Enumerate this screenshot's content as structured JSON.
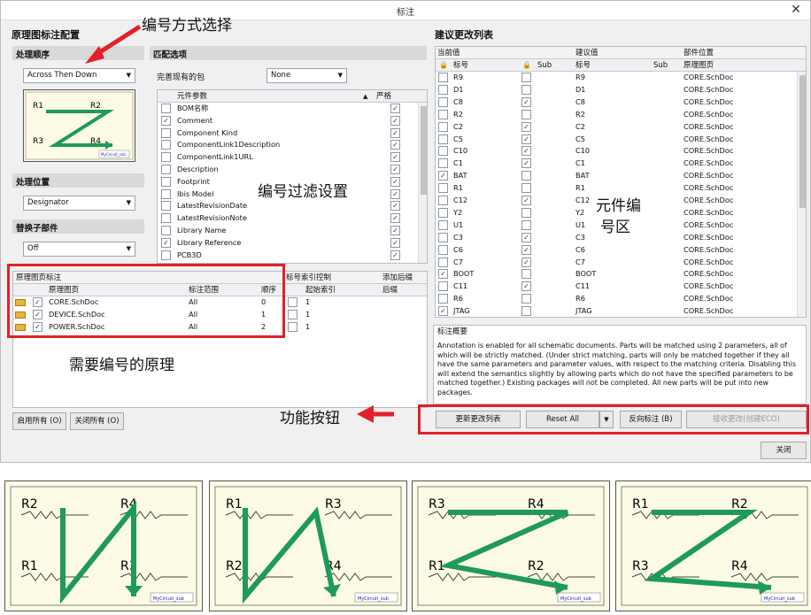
{
  "window": {
    "title": "标注",
    "close": "✕"
  },
  "left": {
    "title": "原理图标注配置",
    "order_section": "处理顺序",
    "order_value": "Across Then Down",
    "location_section": "处理位置",
    "location_value": "Designator",
    "replace_section": "替换子部件",
    "replace_value": "Off",
    "match_section": "匹配选项",
    "complete_label": "完善现有的包",
    "complete_value": "None",
    "param_header": "元件参数",
    "strict_header": "严格",
    "params": [
      {
        "name": "BOM名称",
        "checked": false
      },
      {
        "name": "Comment",
        "checked": true
      },
      {
        "name": "Component Kind",
        "checked": false
      },
      {
        "name": "ComponentLink1Description",
        "checked": false
      },
      {
        "name": "ComponentLink1URL",
        "checked": false
      },
      {
        "name": "Description",
        "checked": false
      },
      {
        "name": "Footprint",
        "checked": false
      },
      {
        "name": "Ibis Model",
        "checked": false
      },
      {
        "name": "LatestRevisionDate",
        "checked": false
      },
      {
        "name": "LatestRevisionNote",
        "checked": false
      },
      {
        "name": "Library Name",
        "checked": false
      },
      {
        "name": "Library Reference",
        "checked": true
      },
      {
        "name": "PCB3D",
        "checked": false
      }
    ],
    "sheet_section": "原理图页标注",
    "sheet_col": "原理图页",
    "scope_col": "标注范围",
    "order_col": "顺序",
    "index_section": "标号索引控制",
    "start_col": "起始索引",
    "suffix_section": "添加后缀",
    "suffix_col": "后缀",
    "sheets": [
      {
        "name": "CORE.SchDoc",
        "scope": "All",
        "order": "0",
        "start": "1"
      },
      {
        "name": "DEVICE.SchDoc",
        "scope": "All",
        "order": "1",
        "start": "1"
      },
      {
        "name": "POWER.SchDoc",
        "scope": "All",
        "order": "2",
        "start": "1"
      }
    ],
    "enable_all": "启用所有 (O)",
    "disable_all": "关闭所有 (O)"
  },
  "right": {
    "title": "建议更改列表",
    "current_group": "当前值",
    "proposed_group": "建议值",
    "location_group": "部件位置",
    "col_designator": "标号",
    "col_sub": "Sub",
    "col_sheet": "原理图页",
    "rows": [
      {
        "cur": "R9",
        "new": "R9",
        "sheet": "CORE.SchDoc",
        "lock1": false,
        "lock2": false
      },
      {
        "cur": "D1",
        "new": "D1",
        "sheet": "CORE.SchDoc",
        "lock1": false,
        "lock2": false
      },
      {
        "cur": "C8",
        "new": "C8",
        "sheet": "CORE.SchDoc",
        "lock1": false,
        "lock2": true
      },
      {
        "cur": "R2",
        "new": "R2",
        "sheet": "CORE.SchDoc",
        "lock1": false,
        "lock2": false
      },
      {
        "cur": "C2",
        "new": "C2",
        "sheet": "CORE.SchDoc",
        "lock1": false,
        "lock2": true
      },
      {
        "cur": "C5",
        "new": "C5",
        "sheet": "CORE.SchDoc",
        "lock1": false,
        "lock2": true
      },
      {
        "cur": "C10",
        "new": "C10",
        "sheet": "CORE.SchDoc",
        "lock1": false,
        "lock2": true
      },
      {
        "cur": "C1",
        "new": "C1",
        "sheet": "CORE.SchDoc",
        "lock1": false,
        "lock2": true
      },
      {
        "cur": "BAT",
        "new": "BAT",
        "sheet": "CORE.SchDoc",
        "lock1": true,
        "lock2": false
      },
      {
        "cur": "R1",
        "new": "R1",
        "sheet": "CORE.SchDoc",
        "lock1": false,
        "lock2": false
      },
      {
        "cur": "C12",
        "new": "C12",
        "sheet": "CORE.SchDoc",
        "lock1": false,
        "lock2": true
      },
      {
        "cur": "Y2",
        "new": "Y2",
        "sheet": "CORE.SchDoc",
        "lock1": false,
        "lock2": false
      },
      {
        "cur": "U1",
        "new": "U1",
        "sheet": "CORE.SchDoc",
        "lock1": false,
        "lock2": false
      },
      {
        "cur": "C3",
        "new": "C3",
        "sheet": "CORE.SchDoc",
        "lock1": false,
        "lock2": true
      },
      {
        "cur": "C6",
        "new": "C6",
        "sheet": "CORE.SchDoc",
        "lock1": false,
        "lock2": true
      },
      {
        "cur": "C7",
        "new": "C7",
        "sheet": "CORE.SchDoc",
        "lock1": false,
        "lock2": true
      },
      {
        "cur": "BOOT",
        "new": "BOOT",
        "sheet": "CORE.SchDoc",
        "lock1": true,
        "lock2": false
      },
      {
        "cur": "C11",
        "new": "C11",
        "sheet": "CORE.SchDoc",
        "lock1": false,
        "lock2": true
      },
      {
        "cur": "R6",
        "new": "R6",
        "sheet": "CORE.SchDoc",
        "lock1": false,
        "lock2": false
      },
      {
        "cur": "JTAG",
        "new": "JTAG",
        "sheet": "CORE.SchDoc",
        "lock1": true,
        "lock2": false
      }
    ],
    "summary_title": "标注概要",
    "summary_text": "Annotation is enabled for all schematic documents. Parts will be matched using 2 parameters, all of which will be strictly matched. (Under strict matching, parts will only be matched together if they all have the same parameters and parameter values, with respect to the matching criteria. Disabling this will extend the semantics slightly by allowing parts which do not have the specified parameters to be matched together.) Existing packages will not be completed. All new parts will be put into new packages.",
    "btn_update": "更新更改列表",
    "btn_reset": "Reset All",
    "btn_back": "反向标注 (B)",
    "btn_accept": "接收更改(创建ECO)",
    "btn_close": "关闭"
  },
  "annotations": {
    "order_method": "编号方式选择",
    "filter": "编号过滤设置",
    "component_area_1": "元件编",
    "component_area_2": "号区",
    "sheets_need": "需要编号的原理",
    "function_buttons": "功能按钮"
  },
  "thumb": {
    "brand": "MyCircuit_sub"
  },
  "examples": [
    {
      "labels": [
        "R2",
        "R4",
        "R1",
        "R3"
      ]
    },
    {
      "labels": [
        "R1",
        "R3",
        "R2",
        "R4"
      ]
    },
    {
      "labels": [
        "R3",
        "R4",
        "R1",
        "R2"
      ]
    },
    {
      "labels": [
        "R1",
        "R2",
        "R3",
        "R4"
      ]
    }
  ],
  "colors": {
    "accent": "#1e9a5a",
    "red": "#e3202a",
    "paper": "#fdfbe6"
  }
}
